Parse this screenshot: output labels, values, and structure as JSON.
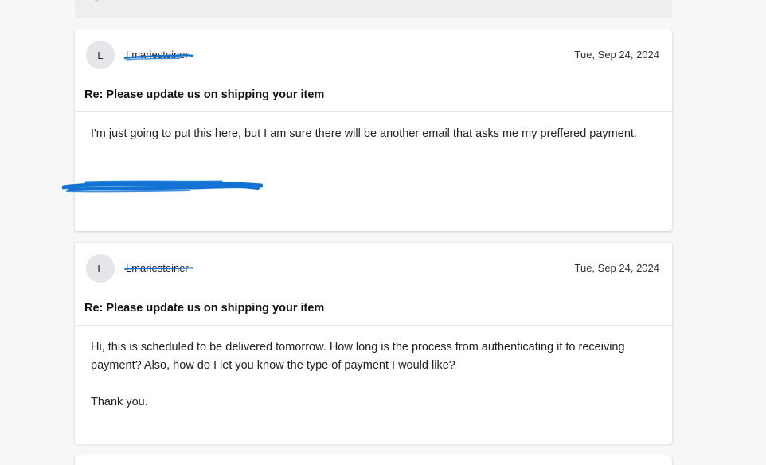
{
  "messages": [
    {
      "avatar_initial": "L",
      "sender": "Lmariesteiner",
      "date": "Tue, Sep 24, 2024",
      "subject": "Re: Please update us on shipping your item",
      "body_line_1": "I'm just going to put this here, but I am sure there will be another email that asks me my preffered payment."
    },
    {
      "avatar_initial": "L",
      "sender": "Lmariesteiner",
      "date": "Tue, Sep 24, 2024",
      "subject": "Re: Please update us on shipping your item",
      "body_line_1": "Hi, this is scheduled to be delivered tomorrow. How long is the process from authenticating it to receiving payment? Also, how do I let you know the type of payment I would like?",
      "body_line_2": "Thank you."
    }
  ],
  "colors": {
    "redaction": "#1273d3",
    "page_bg": "#f7f7f7",
    "avatar_bg": "#e4e6ea"
  }
}
